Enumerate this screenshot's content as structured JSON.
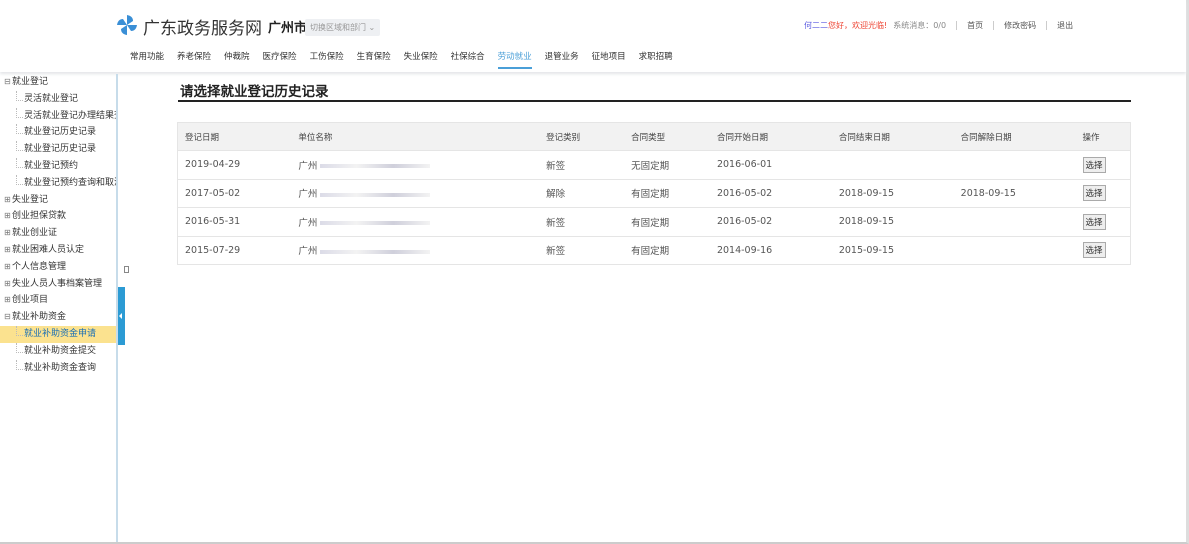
{
  "header": {
    "site_name": "广东政务服务网",
    "city": "广州市",
    "switch_label": "切换区域和部门",
    "user_name": "何二二",
    "welcome": "您好，欢迎光临!",
    "messages": "系统消息：0/0",
    "home": "首页",
    "change_password": "修改密码",
    "logout": "退出",
    "nav": [
      "常用功能",
      "养老保险",
      "仲裁院",
      "医疗保险",
      "工伤保险",
      "生育保险",
      "失业保险",
      "社保综合",
      "劳动就业",
      "退管业务",
      "征地项目",
      "求职招聘"
    ],
    "nav_active": 8,
    "accent": "#4a9fd8"
  },
  "sidebar": [
    {
      "label": "就业登记",
      "level": 1,
      "expanded": true
    },
    {
      "label": "灵活就业登记",
      "level": 2
    },
    {
      "label": "灵活就业登记办理结果查询",
      "level": 2
    },
    {
      "label": "就业登记历史记录",
      "level": 2
    },
    {
      "label": "就业登记历史记录",
      "level": 2
    },
    {
      "label": "就业登记预约",
      "level": 2
    },
    {
      "label": "就业登记预约查询和取消",
      "level": 2
    },
    {
      "label": "失业登记",
      "level": 1,
      "expanded": false
    },
    {
      "label": "创业担保贷款",
      "level": 1,
      "expanded": false
    },
    {
      "label": "就业创业证",
      "level": 1,
      "expanded": false
    },
    {
      "label": "就业困难人员认定",
      "level": 1,
      "expanded": false
    },
    {
      "label": "个人信息管理",
      "level": 1,
      "expanded": false
    },
    {
      "label": "失业人员人事档案管理",
      "level": 1,
      "expanded": false
    },
    {
      "label": "创业项目",
      "level": 1,
      "expanded": false
    },
    {
      "label": "就业补助资金",
      "level": 1,
      "expanded": true
    },
    {
      "label": "就业补助资金申请",
      "level": 2,
      "selected": true
    },
    {
      "label": "就业补助资金提交",
      "level": 2
    },
    {
      "label": "就业补助资金查询",
      "level": 2
    }
  ],
  "main": {
    "title": "请选择就业登记历史记录",
    "columns": [
      "登记日期",
      "单位名称",
      "登记类别",
      "合同类型",
      "合同开始日期",
      "合同结束日期",
      "合同解除日期",
      "操作"
    ],
    "rows": [
      [
        "2019-04-29",
        "广州",
        "新签",
        "无固定期",
        "2016-06-01",
        "",
        "",
        "选择"
      ],
      [
        "2017-05-02",
        "广州",
        "解除",
        "有固定期",
        "2016-05-02",
        "2018-09-15",
        "2018-09-15",
        "选择"
      ],
      [
        "2016-05-31",
        "广州",
        "新签",
        "有固定期",
        "2016-05-02",
        "2018-09-15",
        "",
        "选择"
      ],
      [
        "2015-07-29",
        "广州",
        "新签",
        "有固定期",
        "2014-09-16",
        "2015-09-15",
        "",
        "选择"
      ]
    ]
  }
}
